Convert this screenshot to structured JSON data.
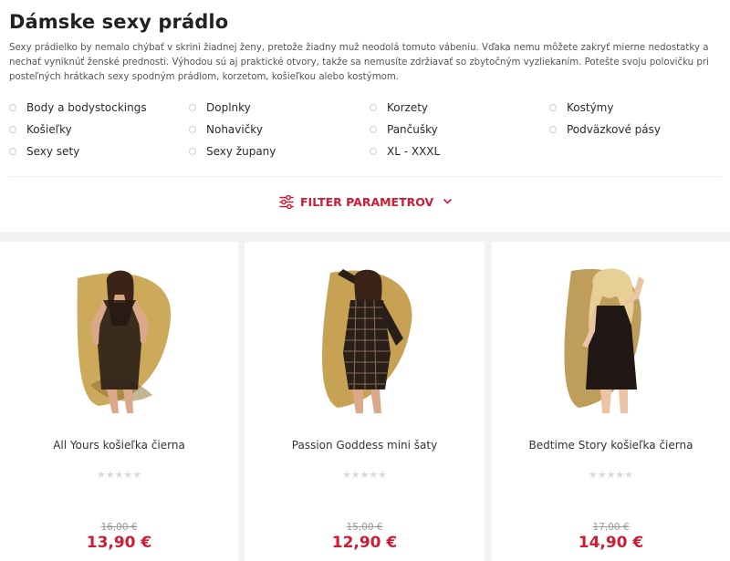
{
  "page": {
    "title": "Dámske sexy prádlo",
    "intro": "Sexy prádielko by nemalo chýbať v skrini žiadnej ženy, pretože žiadny muž neodolá tomuto vábeniu. Vďaka nemu môžete zakryť mierne nedostatky a nechať vyniknúť ženské prednosti. Výhodou sú aj praktické otvory, takže sa nemusíte zdržiavať so zbytočným vyzliekaním. Potešte svoju polovičku pri posteľných hrátkach sexy spodným prádlom, korzetom, košieľkou alebo kostýmom."
  },
  "categories": [
    {
      "label": "Body a bodystockings"
    },
    {
      "label": "Doplnky"
    },
    {
      "label": "Korzety"
    },
    {
      "label": "Kostýmy"
    },
    {
      "label": "Košieľky"
    },
    {
      "label": "Nohavičky"
    },
    {
      "label": "Pančušky"
    },
    {
      "label": "Podväzkové pásy"
    },
    {
      "label": "Sexy sety"
    },
    {
      "label": "Sexy župany"
    },
    {
      "label": "XL - XXXL"
    }
  ],
  "filter": {
    "label": "FILTER PARAMETROV"
  },
  "products": [
    {
      "title": "All Yours košieľka čierna",
      "old_price": "16,00 €",
      "price": "13,90 €",
      "rating": 0,
      "rating_display": "★★★★★"
    },
    {
      "title": "Passion Goddess mini šaty",
      "old_price": "15,00 €",
      "price": "12,90 €",
      "rating": 0,
      "rating_display": "★★★★★"
    },
    {
      "title": "Bedtime Story košieľka čierna",
      "old_price": "17,00 €",
      "price": "14,90 €",
      "rating": 0,
      "rating_display": "★★★★★"
    }
  ],
  "colors": {
    "accent": "#d01b36",
    "grid_background": "#f2f2f2",
    "star_empty": "#d9d9d9"
  },
  "icons": {
    "filter": "sliders-icon",
    "filter_chevron": "chevron-down-icon"
  }
}
